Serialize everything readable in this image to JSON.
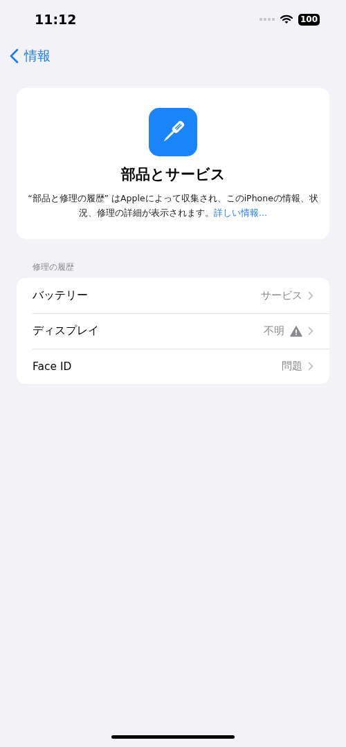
{
  "status_bar": {
    "time": "11:12",
    "battery": "100"
  },
  "nav": {
    "back_label": "情報"
  },
  "header": {
    "title": "部品とサービス",
    "description": "“部品と修理の履歴” はAppleによって収集され、このiPhoneの情報、状況、修理の詳細が表示されます。",
    "link": "詳しい情報..."
  },
  "repair_history": {
    "title": "修理の履歴",
    "rows": [
      {
        "label": "バッテリー",
        "value": "サービス",
        "warning": false
      },
      {
        "label": "ディスプレイ",
        "value": "不明",
        "warning": true
      },
      {
        "label": "Face ID",
        "value": "問題",
        "warning": false
      }
    ]
  }
}
